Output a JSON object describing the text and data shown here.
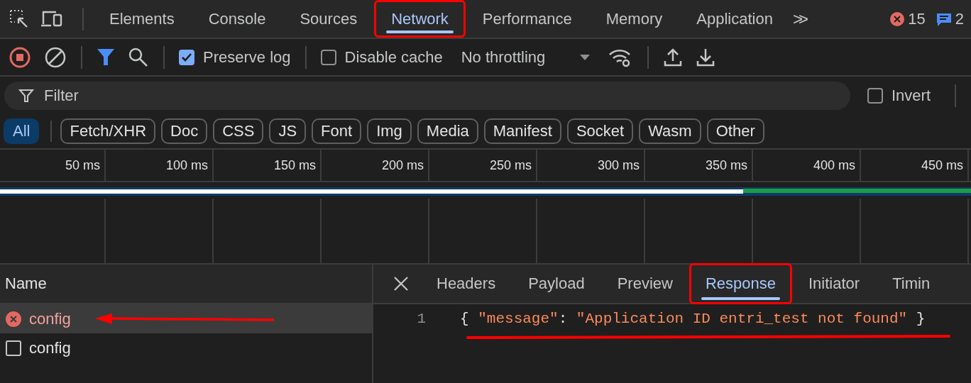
{
  "panel_tabs": [
    {
      "label": "Elements",
      "selected": false,
      "highlighted": false
    },
    {
      "label": "Console",
      "selected": false,
      "highlighted": false
    },
    {
      "label": "Sources",
      "selected": false,
      "highlighted": false
    },
    {
      "label": "Network",
      "selected": true,
      "highlighted": true
    },
    {
      "label": "Performance",
      "selected": false,
      "highlighted": false
    },
    {
      "label": "Memory",
      "selected": false,
      "highlighted": false
    },
    {
      "label": "Application",
      "selected": false,
      "highlighted": false
    }
  ],
  "more_tabs": ">>",
  "error_count": "15",
  "message_count": "2",
  "toolbar": {
    "recording": true,
    "filter_active": true,
    "preserve_log": {
      "label": "Preserve log",
      "checked": true
    },
    "disable_cache": {
      "label": "Disable cache",
      "checked": false
    },
    "throttling": "No throttling"
  },
  "filter": {
    "placeholder": "Filter",
    "invert": {
      "label": "Invert",
      "checked": false
    }
  },
  "type_filters": [
    {
      "label": "All",
      "selected": true
    },
    {
      "label": "Fetch/XHR",
      "selected": false
    },
    {
      "label": "Doc",
      "selected": false
    },
    {
      "label": "CSS",
      "selected": false
    },
    {
      "label": "JS",
      "selected": false
    },
    {
      "label": "Font",
      "selected": false
    },
    {
      "label": "Img",
      "selected": false
    },
    {
      "label": "Media",
      "selected": false
    },
    {
      "label": "Manifest",
      "selected": false
    },
    {
      "label": "Socket",
      "selected": false
    },
    {
      "label": "Wasm",
      "selected": false
    },
    {
      "label": "Other",
      "selected": false
    }
  ],
  "timeline_ticks": [
    "50 ms",
    "100 ms",
    "150 ms",
    "200 ms",
    "250 ms",
    "300 ms",
    "350 ms",
    "400 ms",
    "450 ms"
  ],
  "requests": {
    "column": "Name",
    "rows": [
      {
        "name": "config",
        "failed": true,
        "selected": true,
        "arrow": true
      },
      {
        "name": "config",
        "failed": false,
        "selected": false,
        "arrow": false
      }
    ]
  },
  "details": {
    "tabs": [
      {
        "label": "Headers",
        "selected": false,
        "highlighted": false
      },
      {
        "label": "Payload",
        "selected": false,
        "highlighted": false
      },
      {
        "label": "Preview",
        "selected": false,
        "highlighted": false
      },
      {
        "label": "Response",
        "selected": true,
        "highlighted": true
      },
      {
        "label": "Initiator",
        "selected": false,
        "highlighted": false
      },
      {
        "label": "Timin",
        "selected": false,
        "highlighted": false
      }
    ],
    "lines": [
      {
        "number": "1",
        "underlined": true,
        "tokens": [
          {
            "kind": "punct",
            "text": "{"
          },
          {
            "kind": "key",
            "text": "\"message\""
          },
          {
            "kind": "punct",
            "text": ":"
          },
          {
            "kind": "string",
            "text": "\"Application ID entri_test not found\""
          },
          {
            "kind": "punct",
            "text": "}"
          }
        ]
      }
    ]
  }
}
